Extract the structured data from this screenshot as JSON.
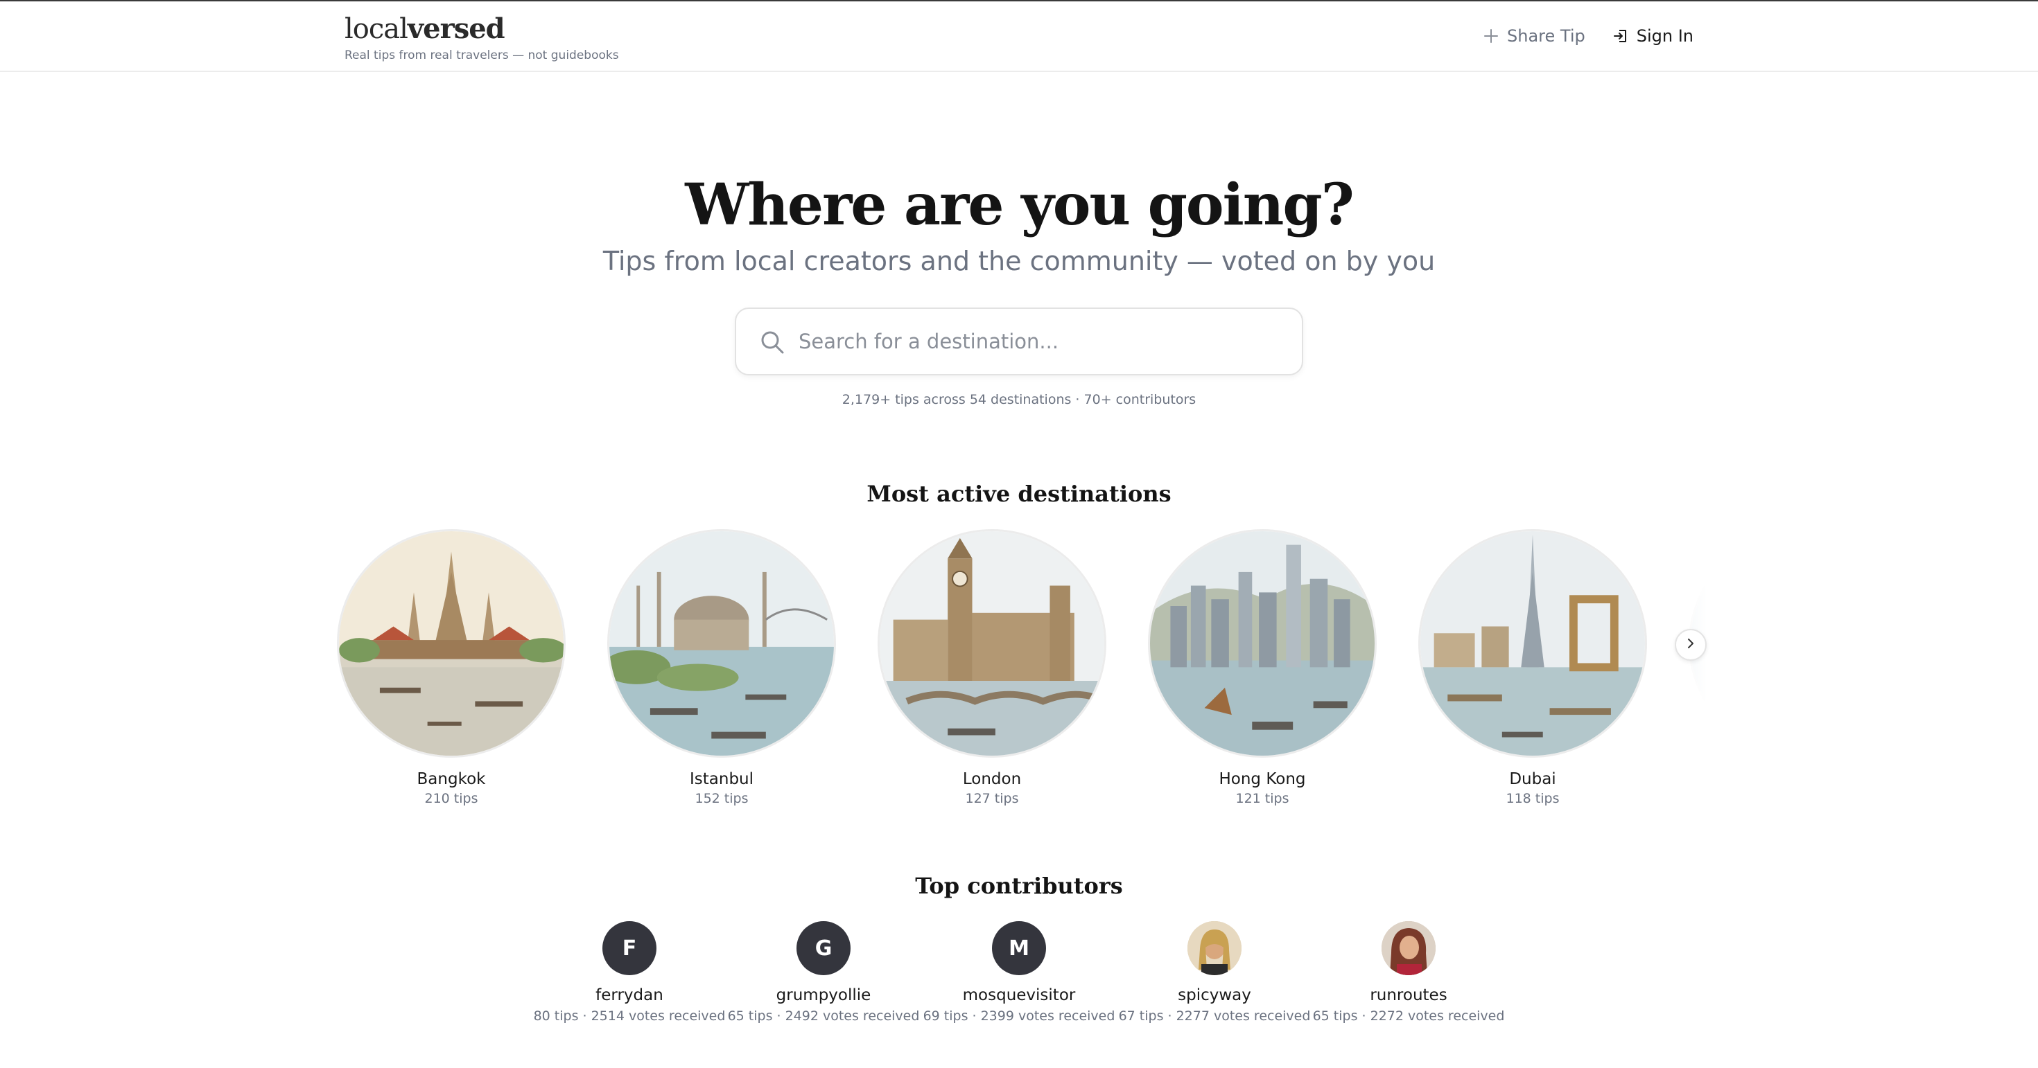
{
  "brand": {
    "logo_light": "local",
    "logo_bold": "versed",
    "tagline": "Real tips from real travelers — not guidebooks"
  },
  "nav": {
    "share_label": "Share Tip",
    "signin_label": "Sign In"
  },
  "hero": {
    "title": "Where are you going?",
    "subtitle": "Tips from local creators and the community — voted on by you"
  },
  "search": {
    "placeholder": "Search for a destination..."
  },
  "stats": "2,179+ tips across 54 destinations · 70+ contributors",
  "destinations": {
    "title": "Most active destinations",
    "items": [
      {
        "name": "Bangkok",
        "tips": "210 tips"
      },
      {
        "name": "Istanbul",
        "tips": "152 tips"
      },
      {
        "name": "London",
        "tips": "127 tips"
      },
      {
        "name": "Hong Kong",
        "tips": "121 tips"
      },
      {
        "name": "Dubai",
        "tips": "118 tips"
      }
    ]
  },
  "contributors": {
    "title": "Top contributors",
    "items": [
      {
        "initial": "F",
        "name": "ferrydan",
        "meta": "80 tips · 2514 votes received"
      },
      {
        "initial": "G",
        "name": "grumpyollie",
        "meta": "65 tips · 2492 votes received"
      },
      {
        "initial": "M",
        "name": "mosquevisitor",
        "meta": "69 tips · 2399 votes received"
      },
      {
        "initial": "",
        "name": "spicyway",
        "meta": "67 tips · 2277 votes received"
      },
      {
        "initial": "",
        "name": "runroutes",
        "meta": "65 tips · 2272 votes received"
      }
    ]
  },
  "icons": {
    "share": "plus-icon",
    "signin": "sign-in-icon",
    "search": "search-icon",
    "next": "chevron-right-icon"
  },
  "colors": {
    "text": "#1a1a1a",
    "muted": "#6b7280",
    "avatar_bg": "#34353d",
    "border": "#e2e2e2"
  }
}
